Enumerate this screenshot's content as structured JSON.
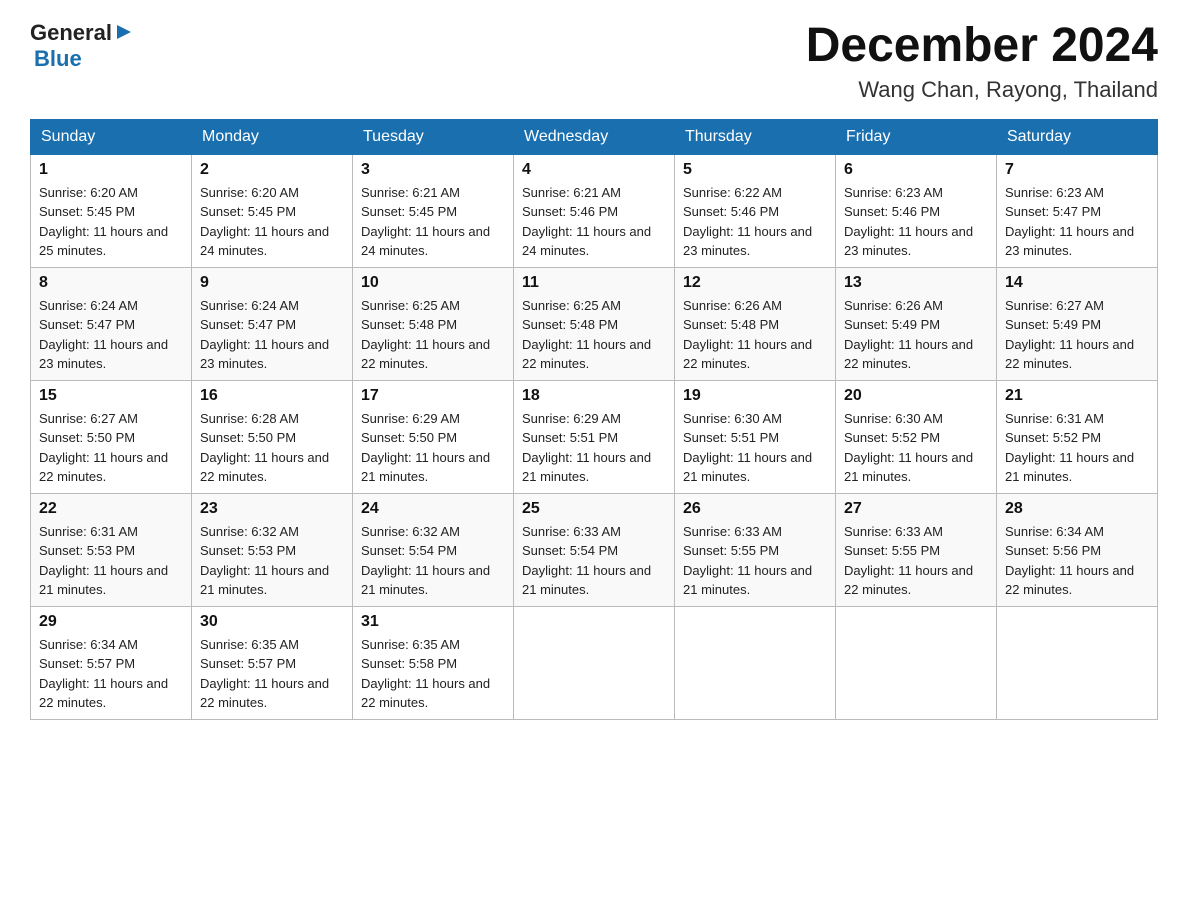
{
  "header": {
    "logo_general": "General",
    "logo_arrow": "▶",
    "logo_blue": "Blue",
    "month_title": "December 2024",
    "location": "Wang Chan, Rayong, Thailand"
  },
  "days_of_week": [
    "Sunday",
    "Monday",
    "Tuesday",
    "Wednesday",
    "Thursday",
    "Friday",
    "Saturday"
  ],
  "weeks": [
    [
      {
        "day": "1",
        "sunrise": "6:20 AM",
        "sunset": "5:45 PM",
        "daylight": "11 hours and 25 minutes."
      },
      {
        "day": "2",
        "sunrise": "6:20 AM",
        "sunset": "5:45 PM",
        "daylight": "11 hours and 24 minutes."
      },
      {
        "day": "3",
        "sunrise": "6:21 AM",
        "sunset": "5:45 PM",
        "daylight": "11 hours and 24 minutes."
      },
      {
        "day": "4",
        "sunrise": "6:21 AM",
        "sunset": "5:46 PM",
        "daylight": "11 hours and 24 minutes."
      },
      {
        "day": "5",
        "sunrise": "6:22 AM",
        "sunset": "5:46 PM",
        "daylight": "11 hours and 23 minutes."
      },
      {
        "day": "6",
        "sunrise": "6:23 AM",
        "sunset": "5:46 PM",
        "daylight": "11 hours and 23 minutes."
      },
      {
        "day": "7",
        "sunrise": "6:23 AM",
        "sunset": "5:47 PM",
        "daylight": "11 hours and 23 minutes."
      }
    ],
    [
      {
        "day": "8",
        "sunrise": "6:24 AM",
        "sunset": "5:47 PM",
        "daylight": "11 hours and 23 minutes."
      },
      {
        "day": "9",
        "sunrise": "6:24 AM",
        "sunset": "5:47 PM",
        "daylight": "11 hours and 23 minutes."
      },
      {
        "day": "10",
        "sunrise": "6:25 AM",
        "sunset": "5:48 PM",
        "daylight": "11 hours and 22 minutes."
      },
      {
        "day": "11",
        "sunrise": "6:25 AM",
        "sunset": "5:48 PM",
        "daylight": "11 hours and 22 minutes."
      },
      {
        "day": "12",
        "sunrise": "6:26 AM",
        "sunset": "5:48 PM",
        "daylight": "11 hours and 22 minutes."
      },
      {
        "day": "13",
        "sunrise": "6:26 AM",
        "sunset": "5:49 PM",
        "daylight": "11 hours and 22 minutes."
      },
      {
        "day": "14",
        "sunrise": "6:27 AM",
        "sunset": "5:49 PM",
        "daylight": "11 hours and 22 minutes."
      }
    ],
    [
      {
        "day": "15",
        "sunrise": "6:27 AM",
        "sunset": "5:50 PM",
        "daylight": "11 hours and 22 minutes."
      },
      {
        "day": "16",
        "sunrise": "6:28 AM",
        "sunset": "5:50 PM",
        "daylight": "11 hours and 22 minutes."
      },
      {
        "day": "17",
        "sunrise": "6:29 AM",
        "sunset": "5:50 PM",
        "daylight": "11 hours and 21 minutes."
      },
      {
        "day": "18",
        "sunrise": "6:29 AM",
        "sunset": "5:51 PM",
        "daylight": "11 hours and 21 minutes."
      },
      {
        "day": "19",
        "sunrise": "6:30 AM",
        "sunset": "5:51 PM",
        "daylight": "11 hours and 21 minutes."
      },
      {
        "day": "20",
        "sunrise": "6:30 AM",
        "sunset": "5:52 PM",
        "daylight": "11 hours and 21 minutes."
      },
      {
        "day": "21",
        "sunrise": "6:31 AM",
        "sunset": "5:52 PM",
        "daylight": "11 hours and 21 minutes."
      }
    ],
    [
      {
        "day": "22",
        "sunrise": "6:31 AM",
        "sunset": "5:53 PM",
        "daylight": "11 hours and 21 minutes."
      },
      {
        "day": "23",
        "sunrise": "6:32 AM",
        "sunset": "5:53 PM",
        "daylight": "11 hours and 21 minutes."
      },
      {
        "day": "24",
        "sunrise": "6:32 AM",
        "sunset": "5:54 PM",
        "daylight": "11 hours and 21 minutes."
      },
      {
        "day": "25",
        "sunrise": "6:33 AM",
        "sunset": "5:54 PM",
        "daylight": "11 hours and 21 minutes."
      },
      {
        "day": "26",
        "sunrise": "6:33 AM",
        "sunset": "5:55 PM",
        "daylight": "11 hours and 21 minutes."
      },
      {
        "day": "27",
        "sunrise": "6:33 AM",
        "sunset": "5:55 PM",
        "daylight": "11 hours and 22 minutes."
      },
      {
        "day": "28",
        "sunrise": "6:34 AM",
        "sunset": "5:56 PM",
        "daylight": "11 hours and 22 minutes."
      }
    ],
    [
      {
        "day": "29",
        "sunrise": "6:34 AM",
        "sunset": "5:57 PM",
        "daylight": "11 hours and 22 minutes."
      },
      {
        "day": "30",
        "sunrise": "6:35 AM",
        "sunset": "5:57 PM",
        "daylight": "11 hours and 22 minutes."
      },
      {
        "day": "31",
        "sunrise": "6:35 AM",
        "sunset": "5:58 PM",
        "daylight": "11 hours and 22 minutes."
      },
      null,
      null,
      null,
      null
    ]
  ]
}
